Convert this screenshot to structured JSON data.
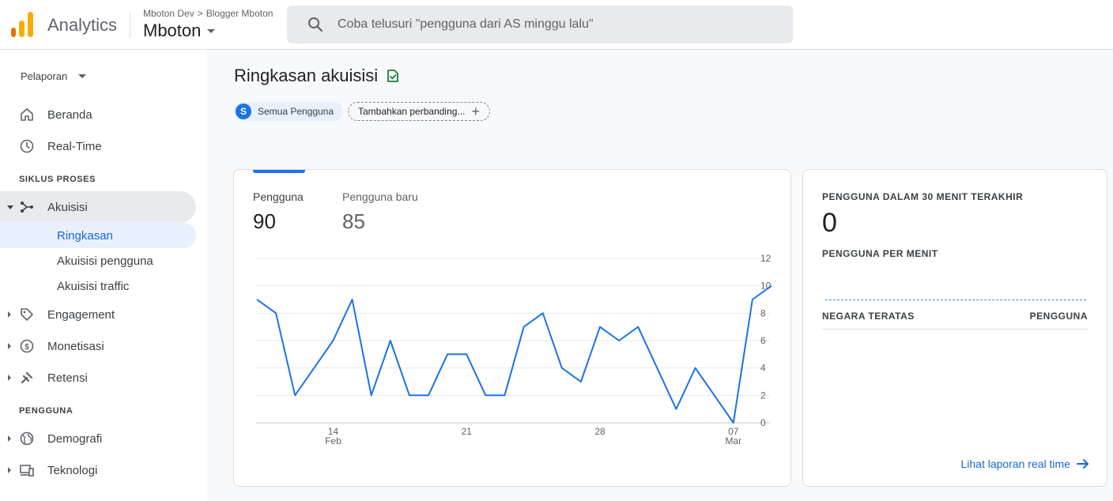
{
  "header": {
    "app_name": "Analytics",
    "breadcrumb_account": "Mboton Dev",
    "breadcrumb_separator": ">",
    "breadcrumb_property": "Blogger Mboton",
    "property_name": "Mboton",
    "search_placeholder": "Coba telusuri \"pengguna dari AS minggu lalu\"",
    "logo_colors": [
      "#f9ab00",
      "#e37400"
    ]
  },
  "sidebar": {
    "dropdown_label": "Pelaporan",
    "home": "Beranda",
    "realtime": "Real-Time",
    "section_lifecycle": "SIKLUS PROSES",
    "acquisition": "Akuisisi",
    "acq_overview": "Ringkasan",
    "acq_user": "Akuisisi pengguna",
    "acq_traffic": "Akuisisi traffic",
    "engagement": "Engagement",
    "monetization": "Monetisasi",
    "retention": "Retensi",
    "section_user": "PENGGUNA",
    "demographics": "Demografi",
    "technology": "Teknologi"
  },
  "main": {
    "page_title": "Ringkasan akuisisi",
    "segment_badge": "S",
    "segment_label": "Semua Pengguna",
    "add_comparison": "Tambahkan perbanding...",
    "metric_users_label": "Pengguna",
    "metric_users_value": "90",
    "metric_new_users_label": "Pengguna baru",
    "metric_new_users_value": "85"
  },
  "chart_data": {
    "type": "line",
    "series": [
      {
        "values": [
          9,
          8,
          2,
          4,
          6,
          9,
          2,
          6,
          2,
          2,
          5,
          5,
          2,
          2,
          7,
          8,
          4,
          3,
          7,
          6,
          7,
          4,
          1,
          4,
          2,
          0,
          9,
          10
        ]
      }
    ],
    "x_tick_labels": [
      {
        "index": 4,
        "day": "14",
        "month": "Feb"
      },
      {
        "index": 11,
        "day": "21",
        "month": ""
      },
      {
        "index": 18,
        "day": "28",
        "month": ""
      },
      {
        "index": 25,
        "day": "07",
        "month": "Mar"
      }
    ],
    "y_ticks": [
      "0",
      "2",
      "4",
      "6",
      "8",
      "10",
      "12"
    ],
    "ylim": [
      0,
      12
    ],
    "line_color": "#1a73e8",
    "grid": true
  },
  "realtime": {
    "title": "PENGGUNA DALAM 30 MENIT TERAKHIR",
    "value": "0",
    "per_minute_label": "PENGGUNA PER MENIT",
    "col_country": "NEGARA TERATAS",
    "col_users": "PENGGUNA",
    "link_label": "Lihat laporan real time"
  }
}
